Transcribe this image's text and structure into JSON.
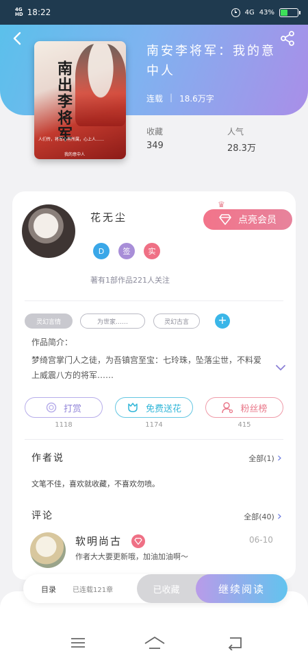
{
  "status_bar": {
    "network_top": "4G",
    "network_bottom": "HD",
    "time": "18:22",
    "network_right": "4G",
    "battery": "43%",
    "battery_level": 0.43
  },
  "book": {
    "cover_title": "南出李将军",
    "cover_subtitle": "我的意中人",
    "cover_blurb": "人们传，将军心有所属，心上人……",
    "title": "南安李将军：我的意中人",
    "status": "连载",
    "word_count": "18.6万字",
    "stats": [
      {
        "label": "收藏",
        "value": "349"
      },
      {
        "label": "人气",
        "value": "28.3万"
      }
    ]
  },
  "author": {
    "name": "花无尘",
    "vip_label": "点亮会员",
    "badges": [
      "D",
      "签",
      "实"
    ],
    "meta": "著有1部作品221人关注"
  },
  "tags": [
    {
      "label": "灵幻言情"
    },
    {
      "label": "为世家……"
    },
    {
      "label": "灵幻古言"
    }
  ],
  "intro": {
    "label": "作品简介：",
    "text": "梦绮宫掌门人之徒，为吾镇宫至宝：七玲珠，坠落尘世，不料爱上威震八方的将军……"
  },
  "actions": [
    {
      "label": "打赏",
      "count": "1118"
    },
    {
      "label": "免费送花",
      "count": "1174"
    },
    {
      "label": "粉丝榜",
      "count": "415"
    }
  ],
  "author_says": {
    "title": "作者说",
    "more": "全部(1)",
    "text": "文笔不佳，喜欢就收藏，不喜欢勿喷。"
  },
  "comments": {
    "title": "评论",
    "more": "全部(40)",
    "items": [
      {
        "user": "软明尚古",
        "date": "06-10",
        "text": "作者大大要更新哦，加油加油啊～"
      }
    ]
  },
  "bottom_bar": {
    "catalog": "目录",
    "catalog_status": "已连载121章",
    "saved": "已收藏",
    "read": "继续阅读"
  },
  "colors": {
    "header_start": "#5bc0eb",
    "header_end": "#a98ee8",
    "vip_pink": "#f2748a",
    "tip_purple": "#8f82d8",
    "flower_cyan": "#31b6d8",
    "fans_pink": "#e9788a",
    "link_blue": "#6c7ce0"
  },
  "icons": [
    "back-arrow-icon",
    "share-icon",
    "crown-icon",
    "diamond-icon",
    "coin-icon",
    "flower-icon",
    "user-icon",
    "chevron-down-icon",
    "chevron-right-icon",
    "menu-icon",
    "home-icon",
    "back-nav-icon"
  ]
}
